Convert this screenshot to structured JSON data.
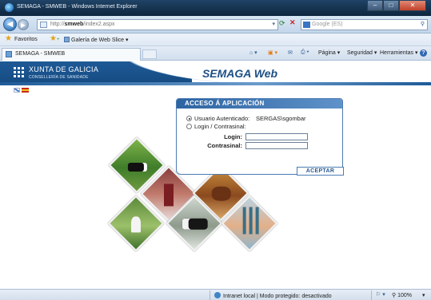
{
  "window": {
    "title": "SEMAGA - SMWEB - Windows Internet Explorer"
  },
  "addressbar": {
    "url_prefix": "http://",
    "url_host": "smweb",
    "url_path": "/index2.aspx",
    "search_placeholder": "Google (ES)"
  },
  "favbar": {
    "favorites_label": "Favoritos",
    "gallery_label": "Galería de Web Slice ▾"
  },
  "tab": {
    "label": "SEMAGA - SMWEB"
  },
  "commands": {
    "page": "Página ▾",
    "safety": "Seguridad ▾",
    "tools": "Herramientas ▾",
    "help": "?"
  },
  "header": {
    "org_name": "XUNTA DE GALICIA",
    "org_sub": "CONSELLERÍA DE SANIDADE",
    "app_title": "SEMAGA Web"
  },
  "login": {
    "title": "ACCESO Á APLICACIÓN",
    "option_authenticated": "Usuario Autenticado:",
    "authenticated_user": "SERGAS\\sgombar",
    "option_login": "Login / Contrasinal:",
    "login_label": "Login:",
    "password_label": "Contrasinal:",
    "login_value": "",
    "password_value": "",
    "accept_label": "ACEPTAR",
    "selected_option": "authenticated"
  },
  "statusbar": {
    "zone_text": "Intranet local | Modo protegido: desactivado",
    "zoom": "100%"
  },
  "colors": {
    "brand_blue": "#1e5a97",
    "panel_border": "#4c7cb3"
  }
}
